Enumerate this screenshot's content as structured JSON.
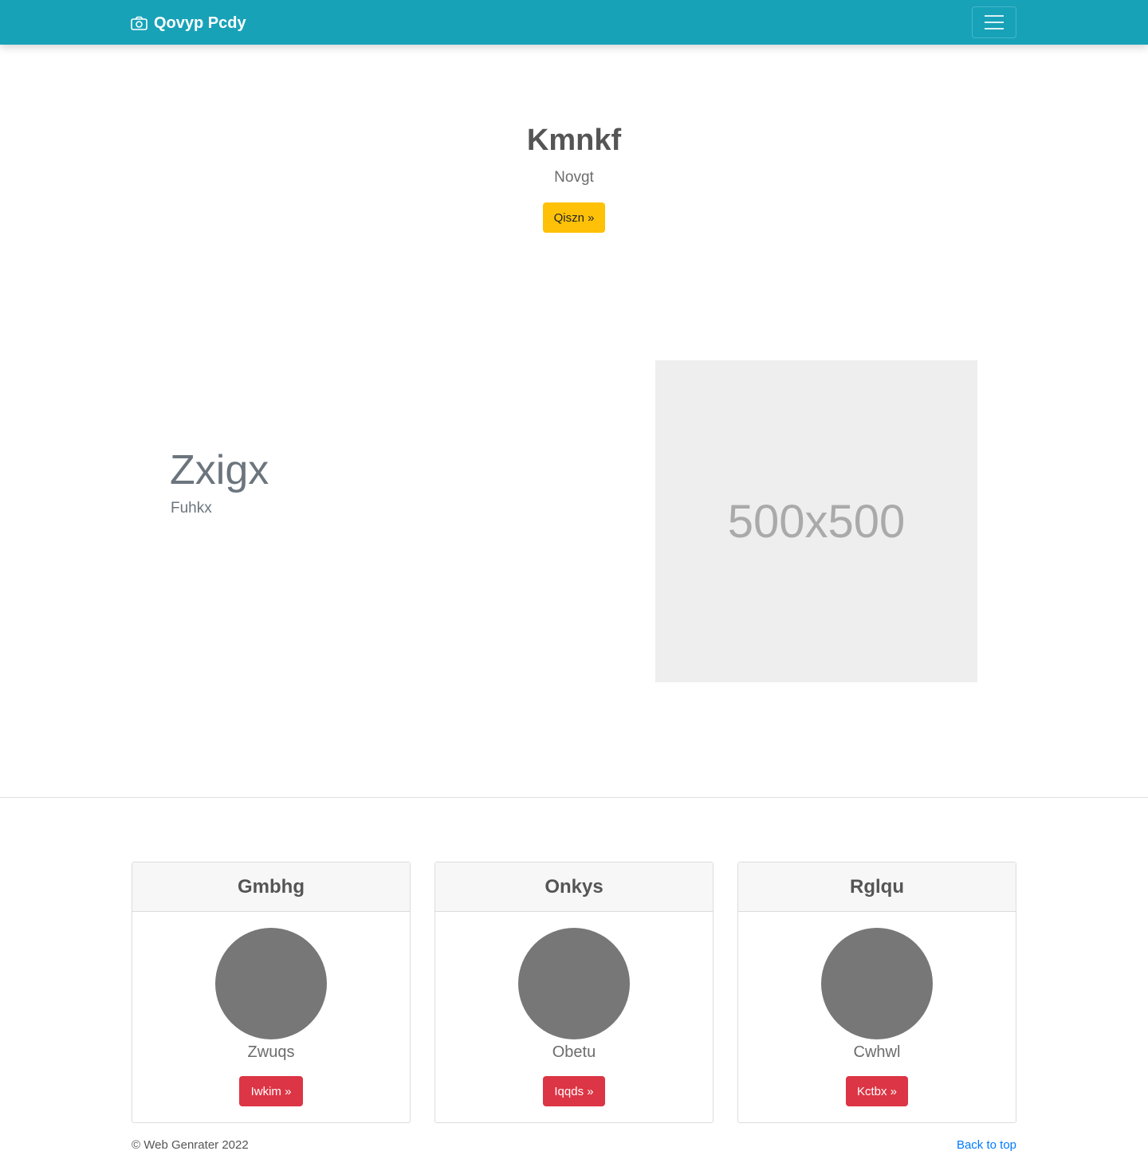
{
  "navbar": {
    "brand": "Qovyp Pcdy",
    "brand_icon": "camera-icon",
    "toggler_icon": "hamburger-menu-icon",
    "background": "#17a2b8"
  },
  "hero": {
    "title": "Kmnkf",
    "subtitle": "Novgt",
    "button_label": "Qiszn »",
    "button_color": "#ffc107"
  },
  "feature": {
    "title": "Zxigx",
    "subtitle": "Fuhkx",
    "image_placeholder": "500x500"
  },
  "cards": [
    {
      "title": "Gmbhg",
      "name": "Zwuqs",
      "button_label": "Iwkim »"
    },
    {
      "title": "Onkys",
      "name": "Obetu",
      "button_label": "Iqqds »"
    },
    {
      "title": "Rglqu",
      "name": "Cwhwl",
      "button_label": "Kctbx »"
    }
  ],
  "card_button_color": "#dc3545",
  "footer": {
    "copyright": "© Web Genrater 2022",
    "back_to_top": "Back to top"
  }
}
